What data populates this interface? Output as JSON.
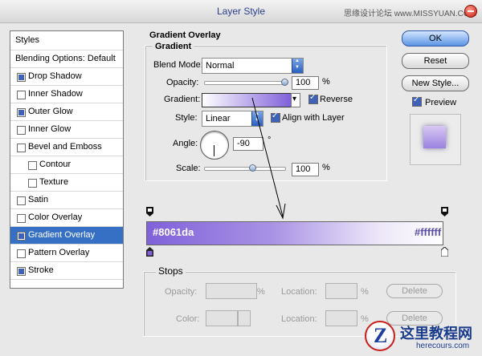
{
  "window": {
    "title": "Layer Style",
    "watermark": "思缘设计论坛  www.MISSYUAN.COM"
  },
  "styles_list": {
    "header": "Styles",
    "items": [
      {
        "label": "Blending Options: Default",
        "checkbox": false,
        "checked": false,
        "indent": false,
        "selected": false
      },
      {
        "label": "Drop Shadow",
        "checkbox": true,
        "checked": true,
        "indent": false,
        "selected": false
      },
      {
        "label": "Inner Shadow",
        "checkbox": true,
        "checked": false,
        "indent": false,
        "selected": false
      },
      {
        "label": "Outer Glow",
        "checkbox": true,
        "checked": true,
        "indent": false,
        "selected": false
      },
      {
        "label": "Inner Glow",
        "checkbox": true,
        "checked": false,
        "indent": false,
        "selected": false
      },
      {
        "label": "Bevel and Emboss",
        "checkbox": true,
        "checked": false,
        "indent": false,
        "selected": false
      },
      {
        "label": "Contour",
        "checkbox": true,
        "checked": false,
        "indent": true,
        "selected": false
      },
      {
        "label": "Texture",
        "checkbox": true,
        "checked": false,
        "indent": true,
        "selected": false
      },
      {
        "label": "Satin",
        "checkbox": true,
        "checked": false,
        "indent": false,
        "selected": false
      },
      {
        "label": "Color Overlay",
        "checkbox": true,
        "checked": false,
        "indent": false,
        "selected": false
      },
      {
        "label": "Gradient Overlay",
        "checkbox": true,
        "checked": true,
        "indent": false,
        "selected": true
      },
      {
        "label": "Pattern Overlay",
        "checkbox": true,
        "checked": false,
        "indent": false,
        "selected": false
      },
      {
        "label": "Stroke",
        "checkbox": true,
        "checked": true,
        "indent": false,
        "selected": false
      }
    ]
  },
  "gradient_overlay": {
    "section_title": "Gradient Overlay",
    "group_title": "Gradient",
    "blend_mode": {
      "label": "Blend Mode:",
      "value": "Normal"
    },
    "opacity": {
      "label": "Opacity:",
      "value": "100",
      "unit": "%",
      "fraction": 1.0
    },
    "gradient": {
      "label": "Gradient:",
      "reverse_label": "Reverse",
      "reverse_checked": true
    },
    "style": {
      "label": "Style:",
      "value": "Linear",
      "align_label": "Align with Layer",
      "align_checked": true
    },
    "angle": {
      "label": "Angle:",
      "value": "-90",
      "unit": "°"
    },
    "scale": {
      "label": "Scale:",
      "value": "100",
      "unit": "%",
      "fraction": 0.6
    }
  },
  "buttons": {
    "ok": "OK",
    "reset": "Reset",
    "new_style": "New Style...",
    "preview_label": "Preview",
    "preview_checked": true
  },
  "gradient_editor": {
    "left_color": "#8061da",
    "right_color": "#ffffff",
    "left_label": "#8061da",
    "right_label": "#ffffff"
  },
  "stops": {
    "title": "Stops",
    "opacity_label": "Opacity:",
    "opacity_unit": "%",
    "color_label": "Color:",
    "location_label": "Location:",
    "location_unit": "%",
    "delete_label": "Delete"
  },
  "logo": {
    "name": "这里教程网",
    "url": "herecours.com"
  }
}
